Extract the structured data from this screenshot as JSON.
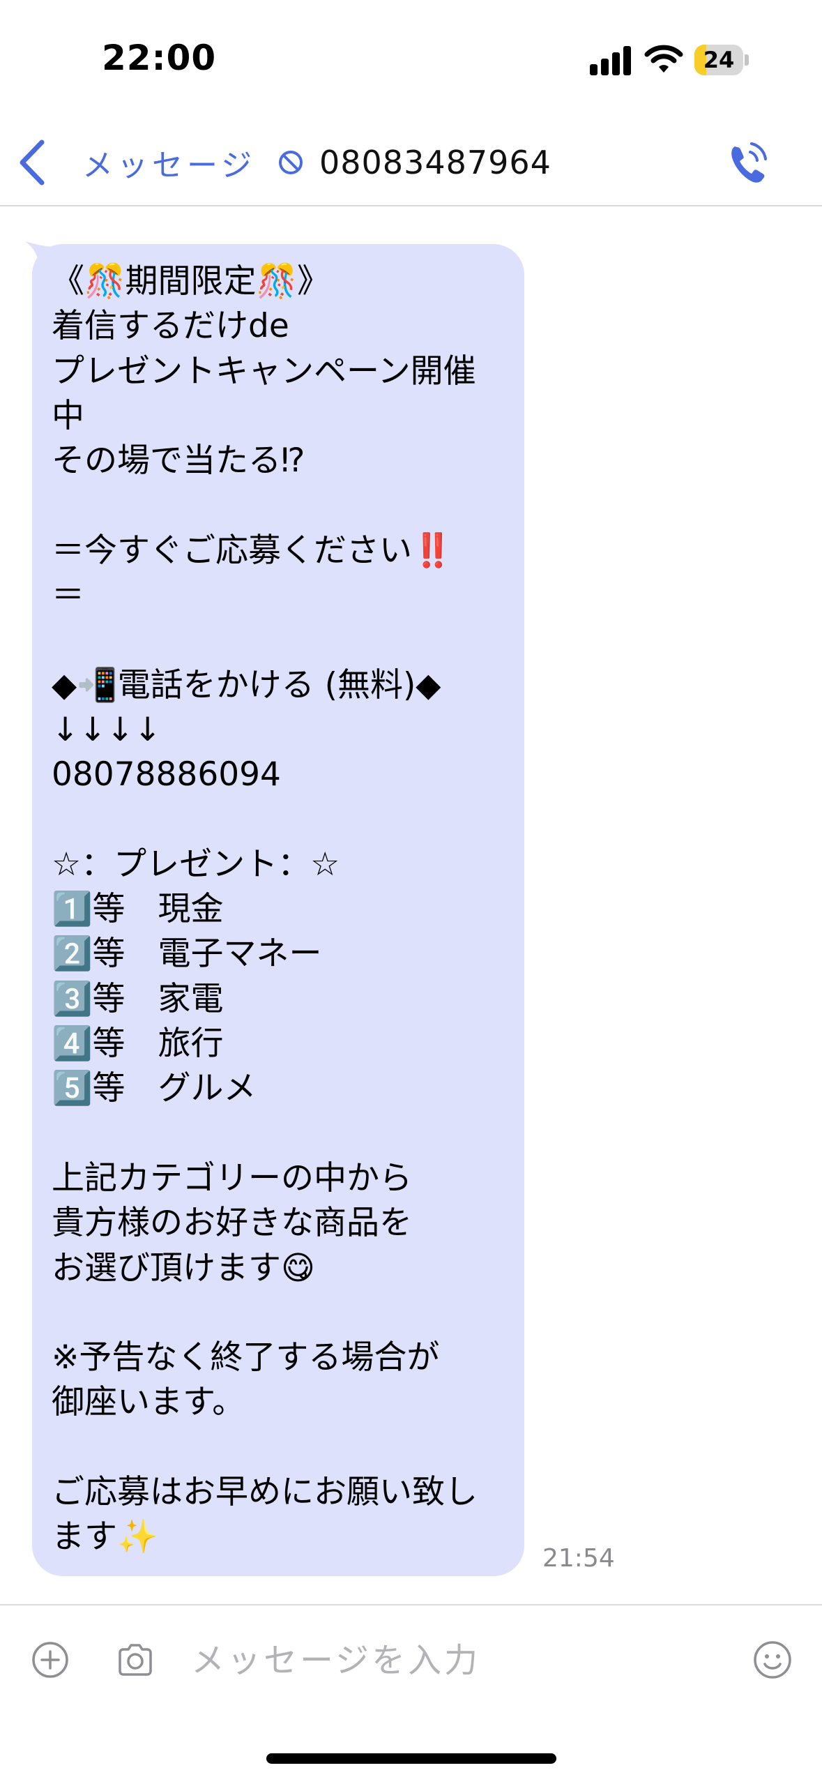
{
  "status_bar": {
    "time": "22:00",
    "battery_level": "24",
    "battery_fraction": 0.24
  },
  "nav": {
    "back_label": "メッセージ",
    "contact_number": "08083487964"
  },
  "message": {
    "lines": [
      "《🎊期間限定🎊》",
      "着信するだけde",
      "プレゼントキャンペーン開催",
      "中",
      "その場で当たる⁉︎",
      "",
      "＝今すぐご応募ください‼️",
      "＝",
      "",
      "◆📲電話をかける (無料)◆",
      "↓↓↓↓",
      "08078886094",
      "",
      "☆：プレゼント：☆",
      "1️⃣等　現金",
      "2️⃣等　電子マネー",
      "3️⃣等　家電",
      "4️⃣等　旅行",
      "5️⃣等　グルメ",
      "",
      "上記カテゴリーの中から",
      "貴方様のお好きな商品を",
      "お選び頂けます😋",
      "",
      "※予告なく終了する場合が",
      "御座います。",
      "",
      "ご応募はお早めにお願い致し",
      "ます✨"
    ],
    "time": "21:54"
  },
  "input": {
    "placeholder": "メッセージを入力"
  },
  "colors": {
    "accent": "#4a6be0",
    "bubble": "#dee1fb",
    "timestamp": "#8a8a8e",
    "battery": "#f7cd2a"
  },
  "icons": {
    "back": "chevron-left-icon",
    "block": "block-icon",
    "call": "phone-call-icon",
    "plus": "plus-circle-icon",
    "camera": "camera-icon",
    "emoji": "smiley-icon"
  }
}
